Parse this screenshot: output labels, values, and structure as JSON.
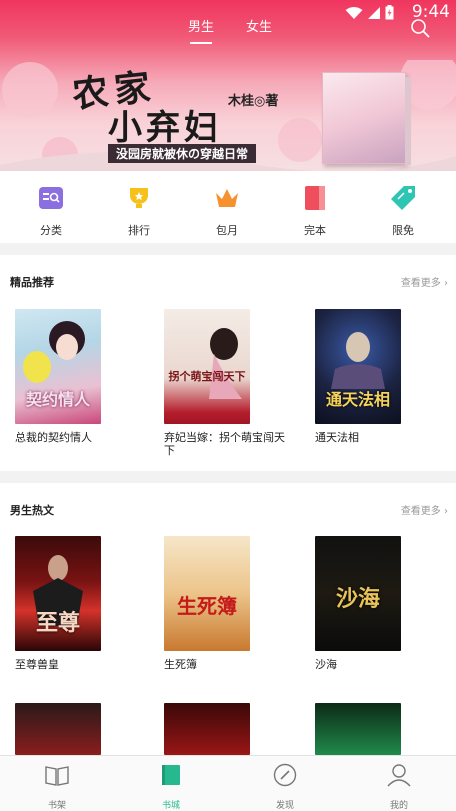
{
  "status": {
    "time": "9:44"
  },
  "tabs": [
    {
      "label": "男生",
      "active": true
    },
    {
      "label": "女生",
      "active": false
    }
  ],
  "banner": {
    "title_line1": "农家",
    "title_line2": "小弃妇",
    "author": "木桂◎著",
    "subtitle": "没园房就被休の穿越日常"
  },
  "categories": [
    {
      "label": "分类",
      "icon": "category-search-icon",
      "color": "#8b6fe0"
    },
    {
      "label": "排行",
      "icon": "trophy-icon",
      "color": "#f5c21b"
    },
    {
      "label": "包月",
      "icon": "crown-icon",
      "color": "#f7902f"
    },
    {
      "label": "完本",
      "icon": "book-icon",
      "color": "#ef4e5c"
    },
    {
      "label": "限免",
      "icon": "tag-icon",
      "color": "#2ec6b3"
    }
  ],
  "sections": [
    {
      "title": "精品推荐",
      "more": "查看更多",
      "books": [
        {
          "title": "总裁的契约情人",
          "cover_text": "契约情人"
        },
        {
          "title": "弃妃当嫁：拐个萌宝闯天下",
          "cover_text": "拐个萌宝闯天下"
        },
        {
          "title": "通天法相",
          "cover_text": "通天法相"
        }
      ]
    },
    {
      "title": "男生热文",
      "more": "查看更多",
      "books": [
        {
          "title": "至尊兽皇",
          "cover_text": "至尊"
        },
        {
          "title": "生死簿",
          "cover_text": "生死簿"
        },
        {
          "title": "沙海",
          "cover_text": "沙海"
        }
      ]
    }
  ],
  "bottom_nav": [
    {
      "label": "书架",
      "icon": "bookshelf-icon",
      "active": false
    },
    {
      "label": "书城",
      "icon": "bookstore-icon",
      "active": true
    },
    {
      "label": "发现",
      "icon": "compass-icon",
      "active": false
    },
    {
      "label": "我的",
      "icon": "profile-icon",
      "active": false
    }
  ],
  "colors": {
    "accent": "#28b88f",
    "header": "#f0355e"
  }
}
